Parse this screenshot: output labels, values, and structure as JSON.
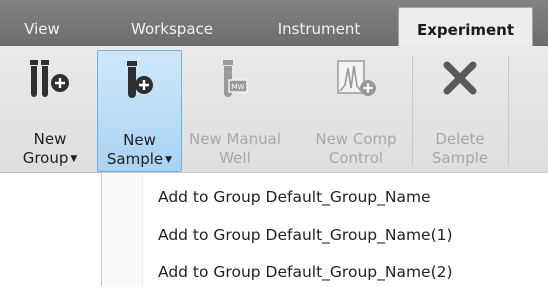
{
  "tabs": [
    {
      "label": "View"
    },
    {
      "label": "Workspace"
    },
    {
      "label": "Instrument"
    },
    {
      "label": "Experiment"
    }
  ],
  "ribbon": {
    "new_group": {
      "line1": "New",
      "line2": "Group",
      "icon": "tubes-add-icon"
    },
    "new_sample": {
      "line1": "New",
      "line2": "Sample",
      "icon": "tube-add-icon"
    },
    "new_manual_well": {
      "line1": "New Manual",
      "line2": "Well",
      "icon": "tube-well-icon"
    },
    "new_comp_control": {
      "line1": "New Comp",
      "line2": "Control",
      "icon": "histogram-add-icon"
    },
    "delete_sample": {
      "line1": "Delete",
      "line2": "Sample",
      "icon": "delete-x-icon"
    }
  },
  "menu": {
    "items": [
      {
        "label": "Add to Group Default_Group_Name"
      },
      {
        "label": "Add to Group Default_Group_Name(1)"
      },
      {
        "label": "Add to Group Default_Group_Name(2)"
      }
    ]
  },
  "colors": {
    "selected": "#a9d3f4",
    "icon": "#2f2f2f",
    "disabled": "#a8a8a8"
  }
}
